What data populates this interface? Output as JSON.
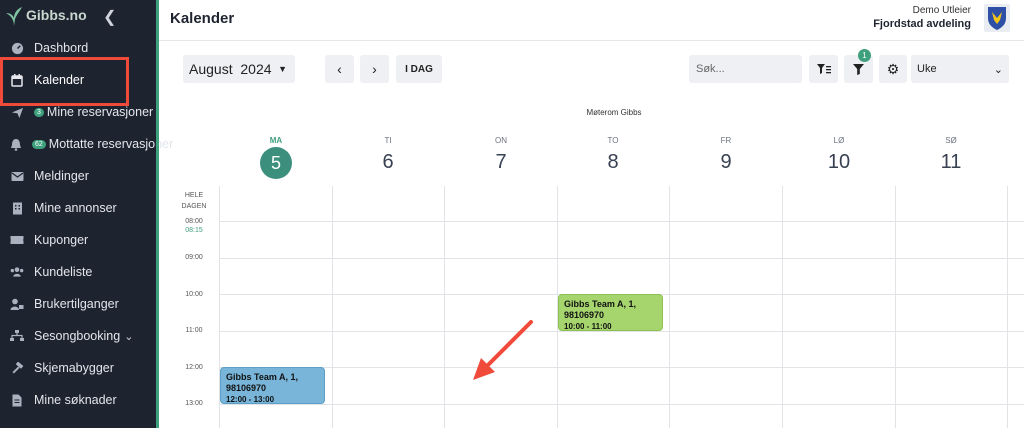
{
  "sidebar": {
    "logo": "Gibbs.no",
    "items": [
      {
        "label": "Dashbord",
        "icon": "gauge-icon"
      },
      {
        "label": "Kalender",
        "icon": "calendar-icon"
      },
      {
        "label": "Mine reservasjoner",
        "icon": "plane-icon",
        "badge": "3"
      },
      {
        "label": "Mottatte reservasjoner",
        "icon": "bell-icon",
        "badge": "62"
      },
      {
        "label": "Meldinger",
        "icon": "envelope-icon"
      },
      {
        "label": "Mine annonser",
        "icon": "building-icon"
      },
      {
        "label": "Kuponger",
        "icon": "ticket-icon"
      },
      {
        "label": "Kundeliste",
        "icon": "users-icon"
      },
      {
        "label": "Brukertilganger",
        "icon": "user-lock-icon"
      },
      {
        "label": "Sesongbooking",
        "icon": "sitemap-icon"
      },
      {
        "label": "Skjemabygger",
        "icon": "hammer-icon"
      },
      {
        "label": "Mine søknader",
        "icon": "file-icon"
      }
    ]
  },
  "header": {
    "title": "Kalender",
    "user_role": "Demo Utleier",
    "user_org": "Fjordstad avdeling"
  },
  "toolbar": {
    "month": "August",
    "year": "2024",
    "today_label": "I DAG",
    "search_placeholder": "Søk...",
    "filter_count": "1",
    "view": "Uke"
  },
  "calendar": {
    "resource": "Møterom Gibbs",
    "days": [
      {
        "name": "MA",
        "num": "5",
        "today": true
      },
      {
        "name": "TI",
        "num": "6"
      },
      {
        "name": "ON",
        "num": "7"
      },
      {
        "name": "TO",
        "num": "8"
      },
      {
        "name": "FR",
        "num": "9"
      },
      {
        "name": "LØ",
        "num": "10"
      },
      {
        "name": "SØ",
        "num": "11"
      }
    ],
    "allday_label": "HELE DAGEN",
    "times": [
      "08:00",
      "09:00",
      "10:00",
      "11:00",
      "12:00",
      "13:00"
    ],
    "now_time": "08:15",
    "events": [
      {
        "title": "Gibbs Team A, 1, 98106970",
        "time": "10:00 - 11:00",
        "color": "#a6d56e"
      },
      {
        "title": "Gibbs Team A, 1, 98106970",
        "time": "12:00 - 13:00",
        "color": "#78b5d9"
      }
    ]
  },
  "colors": {
    "sidebar_bg": "#1e2330",
    "accent": "#3fa07e",
    "highlight": "#ef4a3a"
  }
}
